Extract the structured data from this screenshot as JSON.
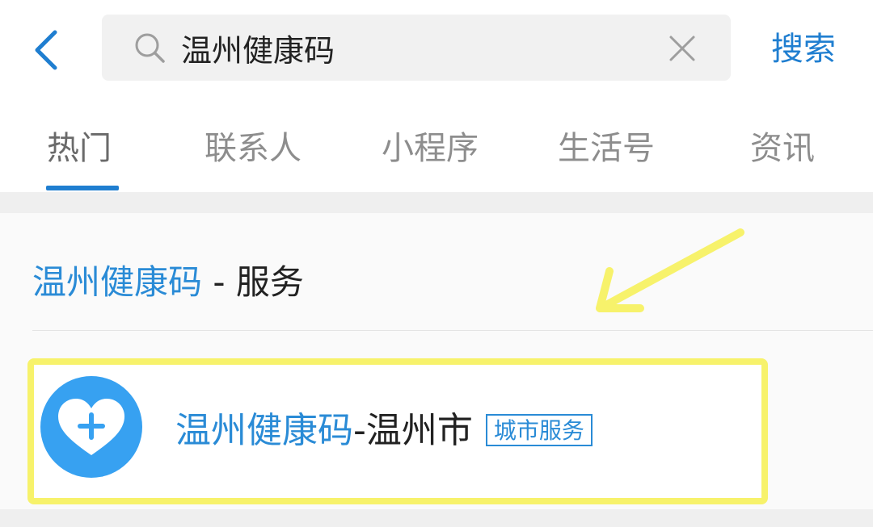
{
  "search": {
    "query": "温州健康码",
    "submit_label": "搜索"
  },
  "icons": {
    "back": "chevron-left-icon",
    "search": "search-icon",
    "clear": "close-icon",
    "app": "heart-plus-icon",
    "annotation": "arrow-icon"
  },
  "tabs": [
    {
      "label": "热门",
      "active": true
    },
    {
      "label": "联系人",
      "active": false
    },
    {
      "label": "小程序",
      "active": false
    },
    {
      "label": "生活号",
      "active": false
    },
    {
      "label": "资讯",
      "active": false
    }
  ],
  "section": {
    "keyword": "温州健康码",
    "suffix": " - 服务"
  },
  "result": {
    "keyword": "温州健康码",
    "suffix": "-温州市",
    "tag": "城市服务"
  },
  "colors": {
    "accent": "#1f7ed0",
    "keyword": "#2a8bd6",
    "highlight": "#f7f26b",
    "icon_bg": "#37a1f1"
  }
}
